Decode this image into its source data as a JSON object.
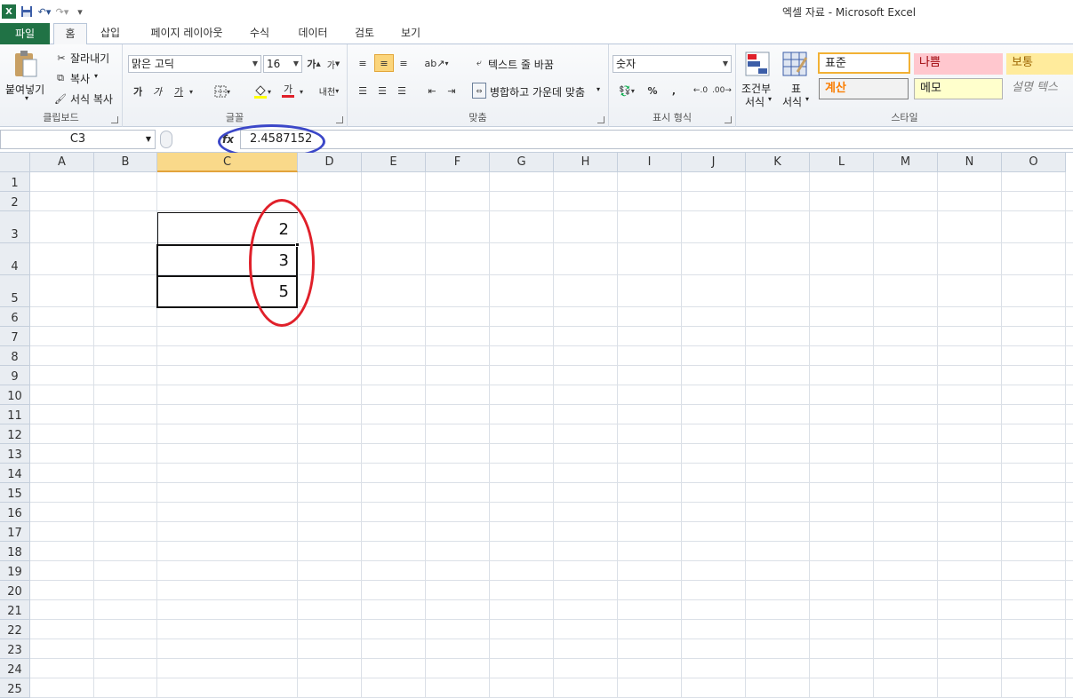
{
  "window": {
    "title": "엑셀 자료  -  Microsoft Excel"
  },
  "tabs": {
    "file": "파일",
    "home": "홈",
    "insert": "삽입",
    "page_layout": "페이지 레이아웃",
    "formulas": "수식",
    "data": "데이터",
    "review": "검토",
    "view": "보기"
  },
  "clipboard": {
    "paste": "붙여넣기",
    "cut": "잘라내기",
    "copy": "복사",
    "format_painter": "서식 복사",
    "label": "클립보드"
  },
  "font": {
    "name": "맑은 고딕",
    "size": "16",
    "bold": "가",
    "italic": "가",
    "underline": "가",
    "color_letter": "가",
    "phonetic": "내천",
    "label": "글꼴"
  },
  "alignment": {
    "wrap_text": "텍스트 줄 바꿈",
    "merge_center": "병합하고 가운데 맞춤",
    "label": "맞춤"
  },
  "number": {
    "format": "숫자",
    "percent": "%",
    "comma": ",",
    "label": "표시 형식"
  },
  "styles": {
    "conditional": "조건부",
    "conditional2": "서식",
    "table": "표",
    "table2": "서식",
    "normal": "표준",
    "bad": "나쁨",
    "neutral": "보통",
    "calculation": "계산",
    "note": "메모",
    "explanatory": "설명 텍스",
    "label": "스타일"
  },
  "formula_bar": {
    "name_box": "C3",
    "fx": "fx",
    "value": "2.4587152"
  },
  "columns": [
    "A",
    "B",
    "C",
    "D",
    "E",
    "F",
    "G",
    "H",
    "I",
    "J",
    "K",
    "L",
    "M",
    "N",
    "O"
  ],
  "rows": [
    "1",
    "2",
    "3",
    "4",
    "5",
    "6",
    "7",
    "8",
    "9",
    "10",
    "11",
    "12",
    "13",
    "14",
    "15",
    "16",
    "17",
    "18",
    "19",
    "20",
    "21",
    "22",
    "23",
    "24",
    "25"
  ],
  "cells": {
    "C3": "2",
    "C4": "3",
    "C5": "5"
  },
  "colors": {
    "file_tab": "#207245",
    "selected_header": "#f9d98a",
    "blue_mark": "#3b47c8",
    "red_mark": "#e0202a"
  }
}
